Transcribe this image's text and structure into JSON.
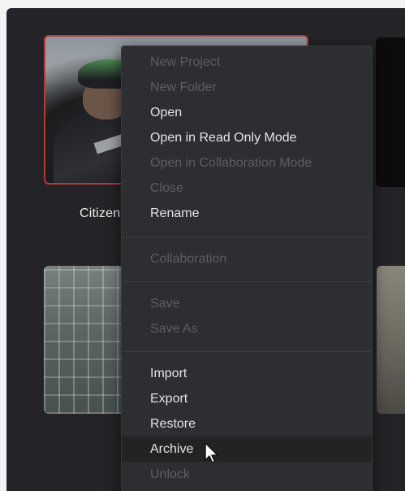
{
  "project": {
    "name": "Citizen"
  },
  "context_menu": {
    "items": [
      {
        "label": "New Project",
        "enabled": false
      },
      {
        "label": "New Folder",
        "enabled": false
      },
      {
        "label": "Open",
        "enabled": true
      },
      {
        "label": "Open in Read Only Mode",
        "enabled": true
      },
      {
        "label": "Open in Collaboration Mode",
        "enabled": false
      },
      {
        "label": "Close",
        "enabled": false
      },
      {
        "label": "Rename",
        "enabled": true
      },
      {
        "label": "Collaboration",
        "enabled": false
      },
      {
        "label": "Save",
        "enabled": false
      },
      {
        "label": "Save As",
        "enabled": false
      },
      {
        "label": "Import",
        "enabled": true
      },
      {
        "label": "Export",
        "enabled": true
      },
      {
        "label": "Restore",
        "enabled": true
      },
      {
        "label": "Archive",
        "enabled": true,
        "hovered": true
      },
      {
        "label": "Unlock",
        "enabled": false
      }
    ]
  },
  "colors": {
    "selection_border": "#b53a36",
    "menu_background": "#2d2e31",
    "enabled_text": "#e4e4e6",
    "disabled_text": "#5d5e62"
  }
}
